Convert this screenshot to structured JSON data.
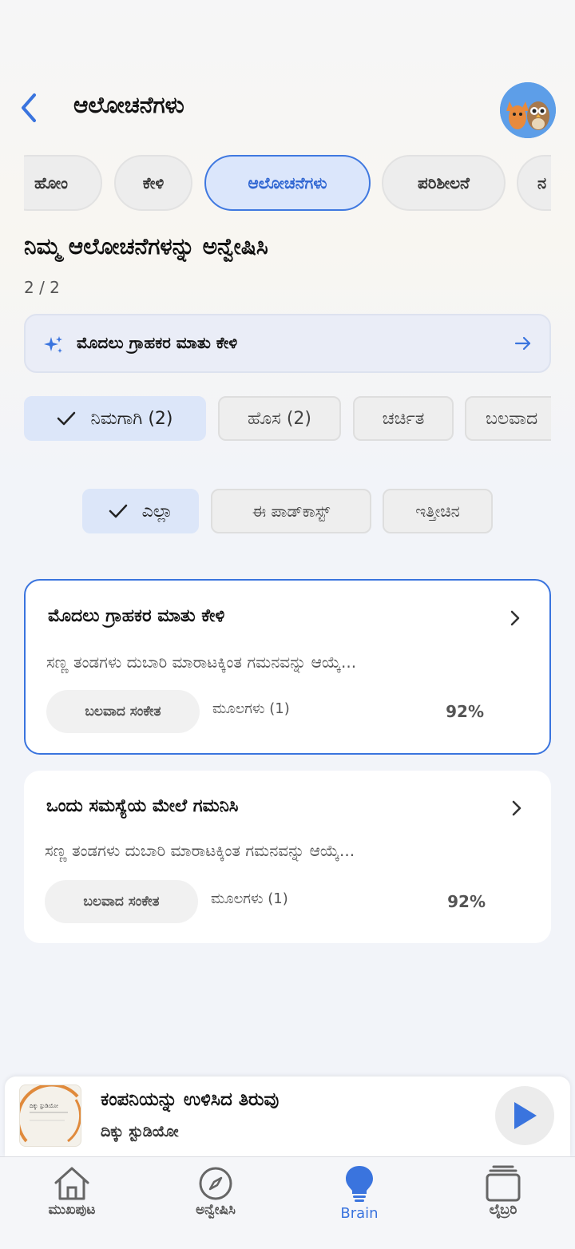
{
  "header": {
    "title": "ಆಲೋಚನೆಗಳು"
  },
  "tabs": [
    {
      "label": "ಹೋಂ",
      "active": false
    },
    {
      "label": "ಕೇಳಿ",
      "active": false
    },
    {
      "label": "ಆಲೋಚನೆಗಳು",
      "active": true
    },
    {
      "label": "ಪರಿಶೀಲನೆ",
      "active": false
    },
    {
      "label": "ನ",
      "active": false
    }
  ],
  "section": {
    "title": "ನಿಮ್ಮ ಆಲೋಚನೆಗಳನ್ನು ಅನ್ವೇಷಿಸಿ",
    "count": "2 / 2"
  },
  "banner": {
    "text": "ಮೊದಲು ಗ್ರಾಹಕರ ಮಾತು ಕೇಳಿ"
  },
  "filters": [
    {
      "label": "ನಿಮಗಾಗಿ (2)",
      "active": true
    },
    {
      "label": "ಹೊಸ (2)",
      "active": false
    },
    {
      "label": "ಚರ್ಚಿತ",
      "active": false
    },
    {
      "label": "ಬಲವಾದ",
      "active": false
    }
  ],
  "subfilters": [
    {
      "label": "ಎಲ್ಲಾ",
      "active": true
    },
    {
      "label": "ಈ ಪಾಡ್‌ಕಾಸ್ಟ್",
      "active": false
    },
    {
      "label": "ಇತ್ತೀಚಿನ",
      "active": false
    }
  ],
  "cards": [
    {
      "title": "ಮೊದಲು ಗ್ರಾಹಕರ ಮಾತು ಕೇಳಿ",
      "desc": "ಸಣ್ಣ ತಂಡಗಳು ದುಬಾರಿ ಮಾರಾಟಕ್ಕಿಂತ ಗಮನವನ್ನು ಆಯ್ಕೆ...",
      "signal": "ಬಲವಾದ ಸಂಕೇತ",
      "sources": "ಮೂಲಗಳು (1)",
      "percent": "92%",
      "selected": true
    },
    {
      "title": "ಒಂದು ಸಮಸ್ಯೆಯ ಮೇಲೆ ಗಮನಿಸಿ",
      "desc": "ಸಣ್ಣ ತಂಡಗಳು ದುಬಾರಿ ಮಾರಾಟಕ್ಕಿಂತ ಗಮನವನ್ನು ಆಯ್ಕೆ...",
      "signal": "ಬಲವಾದ ಸಂಕೇತ",
      "sources": "ಮೂಲಗಳು (1)",
      "percent": "92%",
      "selected": false
    }
  ],
  "player": {
    "title": "ಕಂಪನಿಯನ್ನು ಉಳಿಸಿದ ತಿರುವು",
    "subtitle": "ದಿಕ್ಕು ಸ್ಟುಡಿಯೋ",
    "cover_text": "ದಿಕ್ಕು ಸ್ಟುಡಿಯೋ"
  },
  "nav": [
    {
      "label": "ಮುಖಪುಟ",
      "icon": "home-icon",
      "active": false
    },
    {
      "label": "ಅನ್ವೇಷಿಸಿ",
      "icon": "compass-icon",
      "active": false
    },
    {
      "label": "Brain",
      "icon": "lightbulb-icon",
      "active": true
    },
    {
      "label": "ಲೈಬ್ರರಿ",
      "icon": "library-icon",
      "active": false
    }
  ],
  "colors": {
    "accent": "#3a74de",
    "background": "#f2f4f9"
  }
}
